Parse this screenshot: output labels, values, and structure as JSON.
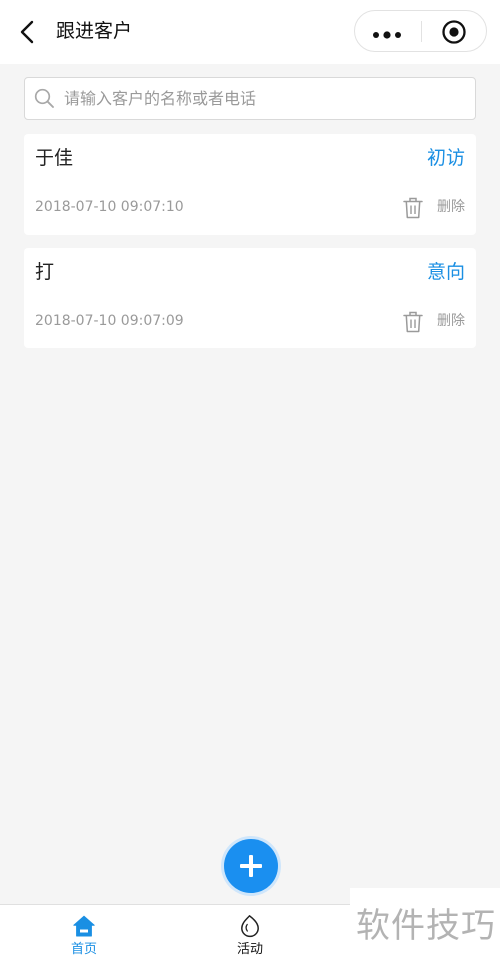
{
  "header": {
    "title": "跟进客户",
    "back_icon": "chevron-left-icon",
    "more_icon": "more-dots-icon",
    "close_icon": "target-icon"
  },
  "search": {
    "placeholder": "请输入客户的名称或者电话",
    "value": "",
    "icon": "search-icon"
  },
  "customers": [
    {
      "name": "于佳",
      "status": "初访",
      "time": "2018-07-10 09:07:10",
      "delete_label": "删除"
    },
    {
      "name": "打",
      "status": "意向",
      "time": "2018-07-10 09:07:09",
      "delete_label": "删除"
    }
  ],
  "fab": {
    "icon": "plus-icon"
  },
  "tabbar": {
    "items": [
      {
        "label": "首页",
        "icon": "home-icon",
        "active": true
      },
      {
        "label": "活动",
        "icon": "activity-icon",
        "active": false
      }
    ]
  },
  "watermark": {
    "text": "软件技巧"
  },
  "colors": {
    "accent": "#1a8fe3",
    "fab": "#1a8ff0",
    "background": "#f5f5f5",
    "muted_text": "#9a9a9a"
  }
}
